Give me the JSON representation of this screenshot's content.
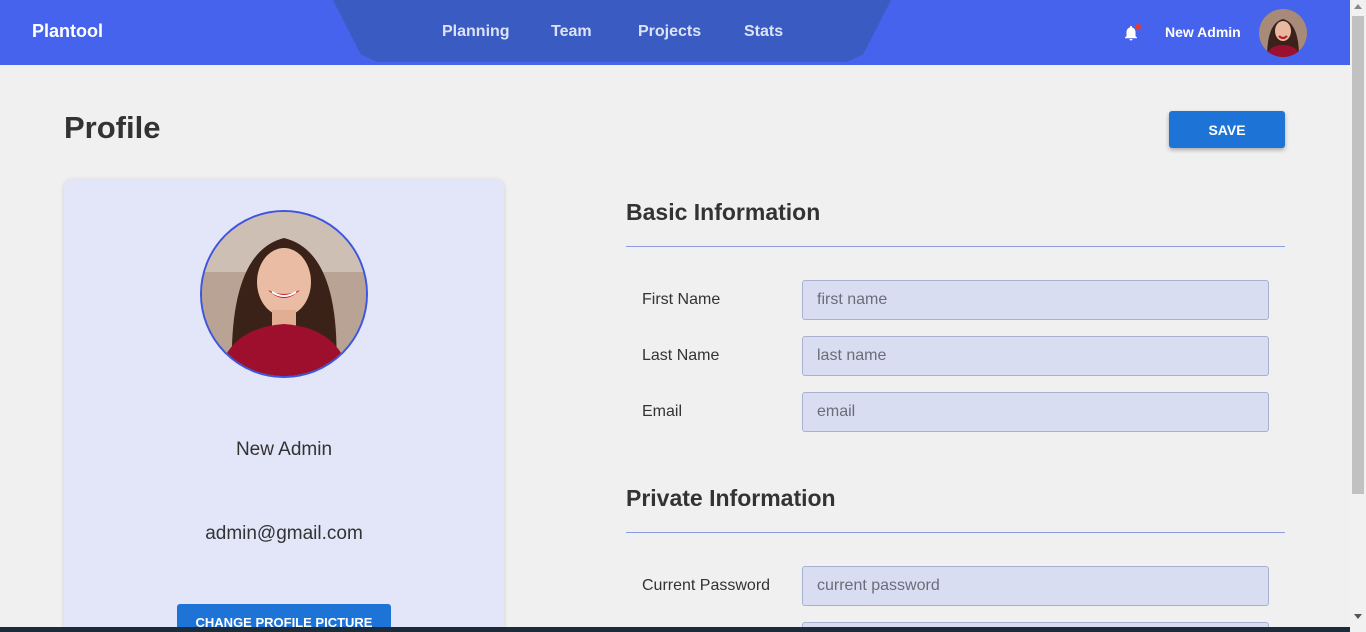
{
  "navbar": {
    "brand": "Plantool",
    "links": [
      "Planning",
      "Team",
      "Projects",
      "Stats"
    ],
    "user_name": "New Admin",
    "accent": "#4563ec",
    "center_color": "#3a5bc2"
  },
  "page": {
    "title": "Profile",
    "save_label": "SAVE"
  },
  "profile_card": {
    "name": "New Admin",
    "email": "admin@gmail.com",
    "change_picture_label": "CHANGE PROFILE PICTURE"
  },
  "basic_info": {
    "title": "Basic Information",
    "fields": [
      {
        "label": "First Name",
        "placeholder": "first name",
        "value": ""
      },
      {
        "label": "Last Name",
        "placeholder": "last name",
        "value": ""
      },
      {
        "label": "Email",
        "placeholder": "email",
        "value": ""
      }
    ]
  },
  "private_info": {
    "title": "Private Information",
    "fields": [
      {
        "label": "Current Password",
        "placeholder": "current password",
        "value": ""
      }
    ]
  },
  "icons": {
    "notifications": "bell-icon",
    "notification_badge_color": "#e53935"
  }
}
